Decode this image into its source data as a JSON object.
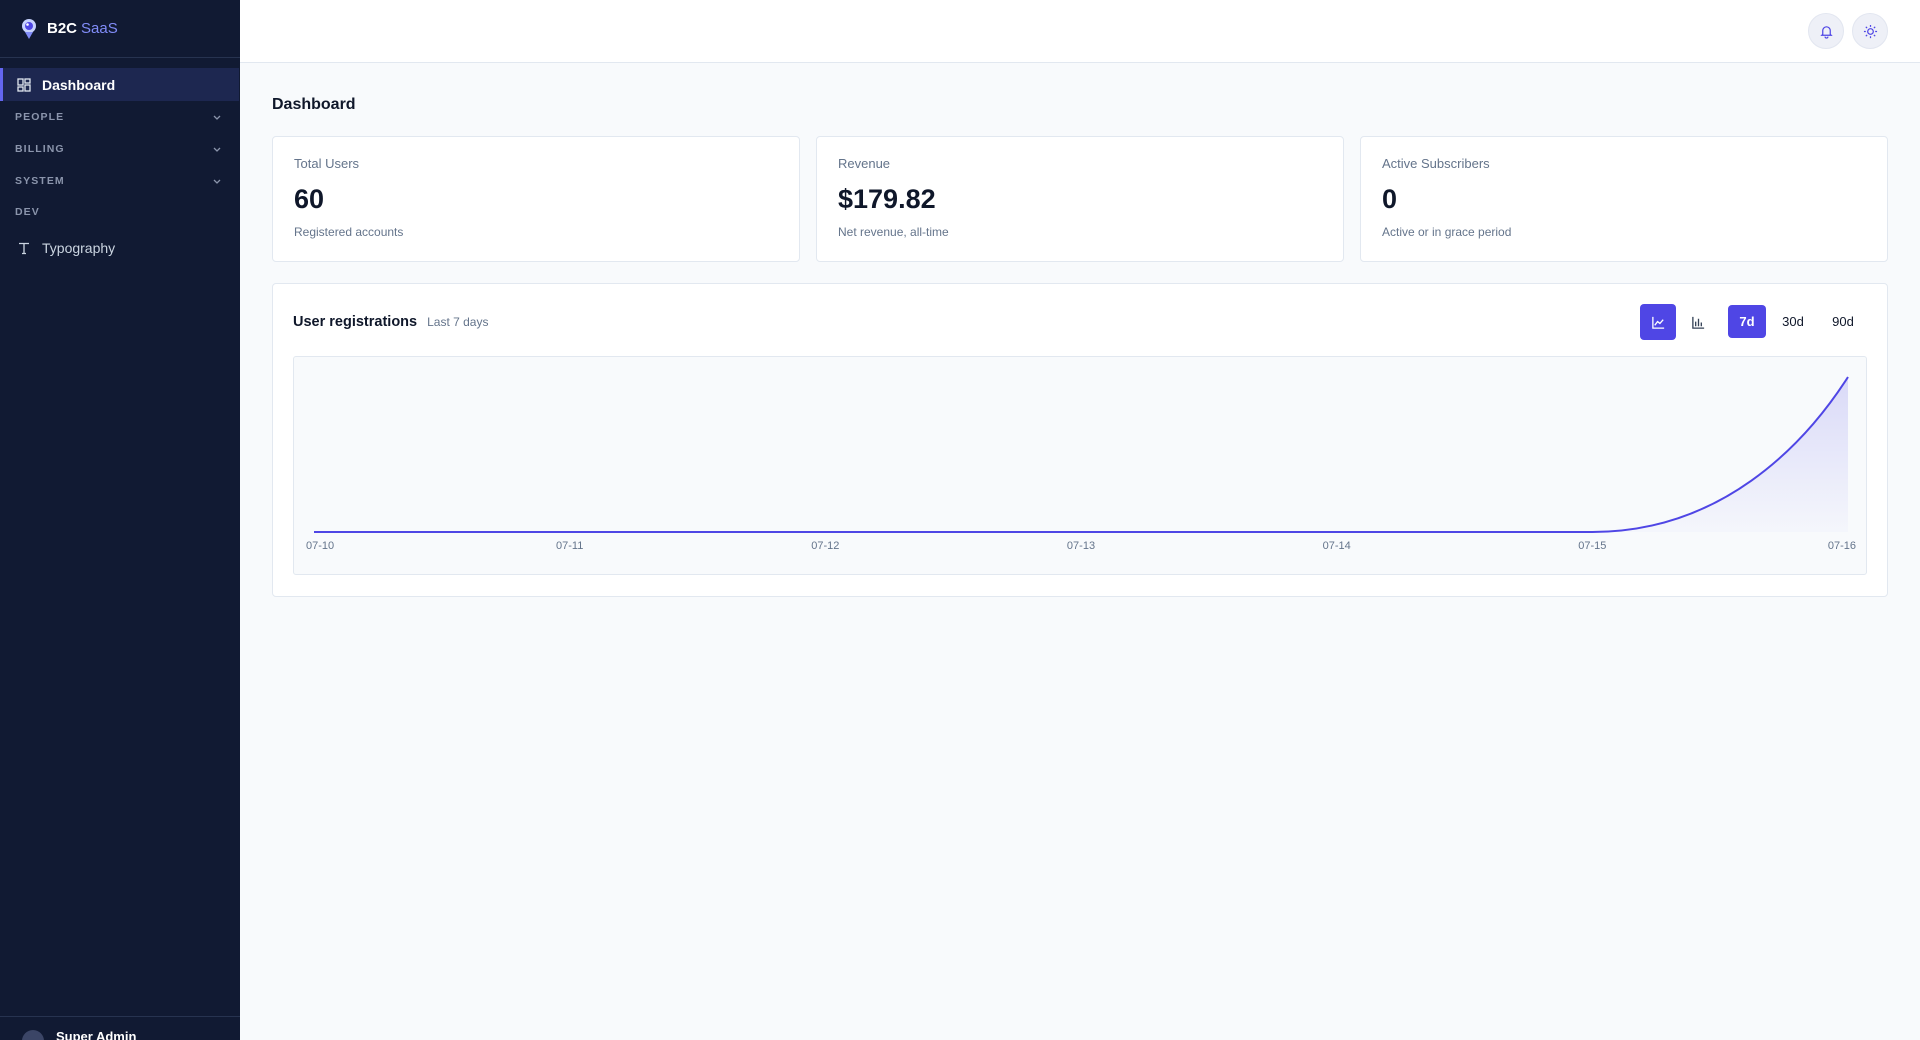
{
  "app": {
    "brand": "B2C",
    "brand_accent": "SaaS"
  },
  "sidebar": {
    "dashboard_label": "Dashboard",
    "sections": [
      "PEOPLE",
      "BILLING",
      "SYSTEM"
    ],
    "dev_section": "DEV",
    "typography_label": "Typography",
    "user_name": "Super Admin"
  },
  "page": {
    "title": "Dashboard"
  },
  "stats": [
    {
      "label": "Total Users",
      "value": "60",
      "sub": "Registered accounts"
    },
    {
      "label": "Revenue",
      "value": "$179.82",
      "sub": "Net revenue, all-time"
    },
    {
      "label": "Active Subscribers",
      "value": "0",
      "sub": "Active or in grace period"
    }
  ],
  "chart_panel": {
    "title": "User registrations",
    "subtitle": "Last 7 days",
    "ranges": [
      "7d",
      "30d",
      "90d"
    ],
    "active_range": "7d",
    "active_chart_type": "area"
  },
  "colors": {
    "accent": "#4f46e5",
    "sidebar_bg": "#111a33"
  },
  "icons": {
    "bell": "bell-icon",
    "theme": "sun-icon",
    "area_chart": "area-chart-icon",
    "bar_chart": "bar-chart-icon"
  },
  "chart_data": {
    "type": "area",
    "x": [
      "07-10",
      "07-11",
      "07-12",
      "07-13",
      "07-14",
      "07-15",
      "07-16"
    ],
    "series": [
      {
        "values": [
          0,
          0,
          0,
          0,
          0,
          0,
          60
        ]
      }
    ],
    "title": "User registrations",
    "subtitle": "Last 7 days",
    "grid": false
  }
}
